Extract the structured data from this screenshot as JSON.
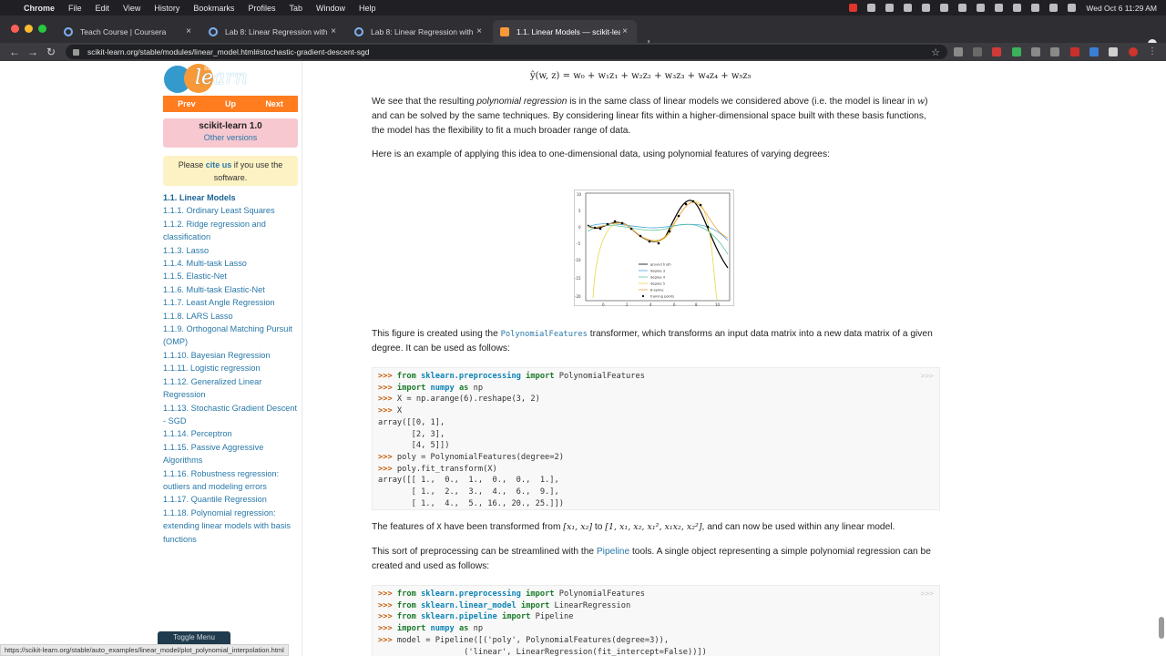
{
  "menubar": {
    "items": [
      "Chrome",
      "File",
      "Edit",
      "View",
      "History",
      "Bookmarks",
      "Profiles",
      "Tab",
      "Window",
      "Help"
    ],
    "clock": "Wed Oct 6  11:29 AM"
  },
  "tabs": [
    {
      "title": "Teach Course | Coursera",
      "active": false
    },
    {
      "title": "Lab 8: Linear Regression with",
      "active": false
    },
    {
      "title": "Lab 8: Linear Regression with",
      "active": false
    },
    {
      "title": "1.1. Linear Models — scikit-lear",
      "active": true
    }
  ],
  "toolbar": {
    "url": "scikit-learn.org/stable/modules/linear_model.html#stochastic-gradient-descent-sgd"
  },
  "sidebar": {
    "logo_text": "learn",
    "logo_prefix": "scikit",
    "nav": {
      "prev": "Prev",
      "up": "Up",
      "next": "Next"
    },
    "version": "scikit-learn 1.0",
    "other_versions": "Other versions",
    "cite_pre": "Please ",
    "cite_link": "cite us",
    "cite_post": " if you use the software.",
    "toc": [
      "1.1. Linear Models",
      "1.1.1. Ordinary Least Squares",
      "1.1.2. Ridge regression and classification",
      "1.1.3. Lasso",
      "1.1.4. Multi-task Lasso",
      "1.1.5. Elastic-Net",
      "1.1.6. Multi-task Elastic-Net",
      "1.1.7. Least Angle Regression",
      "1.1.8. LARS Lasso",
      "1.1.9. Orthogonal Matching Pursuit (OMP)",
      "1.1.10. Bayesian Regression",
      "1.1.11. Logistic regression",
      "1.1.12. Generalized Linear Regression",
      "1.1.13. Stochastic Gradient Descent - SGD",
      "1.1.14. Perceptron",
      "1.1.15. Passive Aggressive Algorithms",
      "1.1.16. Robustness regression: outliers and modeling errors",
      "1.1.17. Quantile Regression",
      "1.1.18. Polynomial regression: extending linear models with basis functions"
    ],
    "toggle_menu": "Toggle Menu"
  },
  "main": {
    "formula": "ŷ(w, z) = w₀ + w₁z₁ + w₂z₂ + w₃z₃ + w₄z₄ + w₅z₅",
    "para1_a": "We see that the resulting ",
    "para1_em": "polynomial regression",
    "para1_b": " is in the same class of linear models we considered above (i.e. the model is linear in ",
    "para1_w": "w",
    "para1_c": ") and can be solved by the same techniques. By considering linear fits within a higher-dimensional space built with these basis functions, the model has the flexibility to fit a much broader range of data.",
    "para2": "Here is an example of applying this idea to one-dimensional data, using polynomial features of varying degrees:",
    "para3_a": "This figure is created using the ",
    "para3_code": "PolynomialFeatures",
    "para3_b": " transformer, which transforms an input data matrix into a new data matrix of a given degree. It can be used as follows:",
    "code1": [
      {
        "pr": ">>> ",
        "kw1": "from",
        "mod": " sklearn.preprocessing ",
        "kw2": "import",
        "rest": " PolynomialFeatures"
      },
      {
        "pr": ">>> ",
        "kw1": "import",
        "mod": " numpy ",
        "kw2": "as",
        "rest": " np"
      },
      {
        "pr": ">>> ",
        "rest": "X = np.arange(6).reshape(3, 2)"
      },
      {
        "pr": ">>> ",
        "rest": "X"
      },
      {
        "rest": "array([[0, 1],"
      },
      {
        "rest": "       [2, 3],"
      },
      {
        "rest": "       [4, 5]])"
      },
      {
        "pr": ">>> ",
        "rest": "poly = PolynomialFeatures(degree=2)"
      },
      {
        "pr": ">>> ",
        "rest": "poly.fit_transform(X)"
      },
      {
        "rest": "array([[ 1.,  0.,  1.,  0.,  0.,  1.],"
      },
      {
        "rest": "       [ 1.,  2.,  3.,  4.,  6.,  9.],"
      },
      {
        "rest": "       [ 1.,  4.,  5., 16., 20., 25.]])"
      }
    ],
    "para4_a": "The features of ",
    "para4_code": "X",
    "para4_b": " have been transformed from ",
    "para4_m1": "[x₁, x₂]",
    "para4_c": " to ",
    "para4_m2": "[1, x₁, x₂, x₁², x₁x₂, x₂²]",
    "para4_d": ", and can now be used within any linear model.",
    "para5_a": "This sort of preprocessing can be streamlined with the ",
    "para5_link": "Pipeline",
    "para5_b": " tools. A single object representing a simple polynomial regression can be created and used as follows:",
    "code2": [
      {
        "pr": ">>> ",
        "kw1": "from",
        "mod": " sklearn.preprocessing ",
        "kw2": "import",
        "rest": " PolynomialFeatures"
      },
      {
        "pr": ">>> ",
        "kw1": "from",
        "mod": " sklearn.linear_model ",
        "kw2": "import",
        "rest": " LinearRegression"
      },
      {
        "pr": ">>> ",
        "kw1": "from",
        "mod": " sklearn.pipeline ",
        "kw2": "import",
        "rest": " Pipeline"
      },
      {
        "pr": ">>> ",
        "kw1": "import",
        "mod": " numpy ",
        "kw2": "as",
        "rest": " np"
      },
      {
        "pr": ">>> ",
        "rest": "model = Pipeline([('poly', PolynomialFeatures(degree=3)),"
      },
      {
        "rest": "                  ('linear', LinearRegression(fit_intercept=False))])"
      }
    ],
    "copy_marker": ">>>"
  },
  "status_url": "https://scikit-learn.org/stable/auto_examples/linear_model/plot_polynomial_interpolation.html",
  "figure": {
    "legend": [
      "ground truth",
      "degree 3",
      "degree 4",
      "degree 5",
      "B-spline",
      "training points"
    ],
    "yticks": [
      "10",
      "5",
      "0",
      "-5",
      "-10",
      "-15",
      "-20"
    ],
    "xticks": [
      "0",
      "2",
      "4",
      "6",
      "8",
      "10"
    ],
    "colors": {
      "truth": "#000000",
      "d3": "#4aa3df",
      "d4": "#5cc6a0",
      "d5": "#e8d84a",
      "bspline": "#f0a040"
    }
  }
}
